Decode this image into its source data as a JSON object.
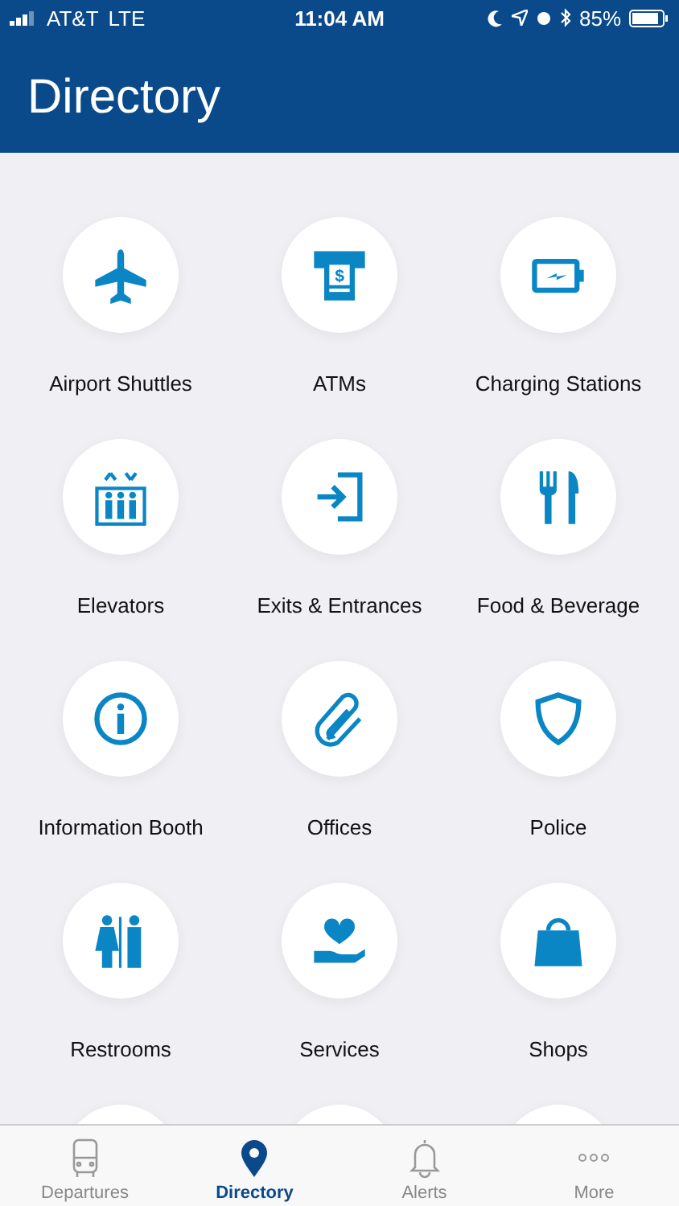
{
  "status_bar": {
    "carrier": "AT&T",
    "network": "LTE",
    "time": "11:04 AM",
    "battery": "85%"
  },
  "header": {
    "title": "Directory"
  },
  "atm_icon_symbol": "$",
  "directory": [
    {
      "label": "Airport Shuttles"
    },
    {
      "label": "ATMs"
    },
    {
      "label": "Charging Stations"
    },
    {
      "label": "Elevators"
    },
    {
      "label": "Exits & Entrances"
    },
    {
      "label": "Food & Beverage"
    },
    {
      "label": "Information Booth"
    },
    {
      "label": "Offices"
    },
    {
      "label": "Police"
    },
    {
      "label": "Restrooms"
    },
    {
      "label": "Services"
    },
    {
      "label": "Shops"
    }
  ],
  "tab_bar": [
    {
      "label": "Departures",
      "selected": false
    },
    {
      "label": "Directory",
      "selected": true
    },
    {
      "label": "Alerts",
      "selected": false
    },
    {
      "label": "More",
      "selected": false
    }
  ]
}
